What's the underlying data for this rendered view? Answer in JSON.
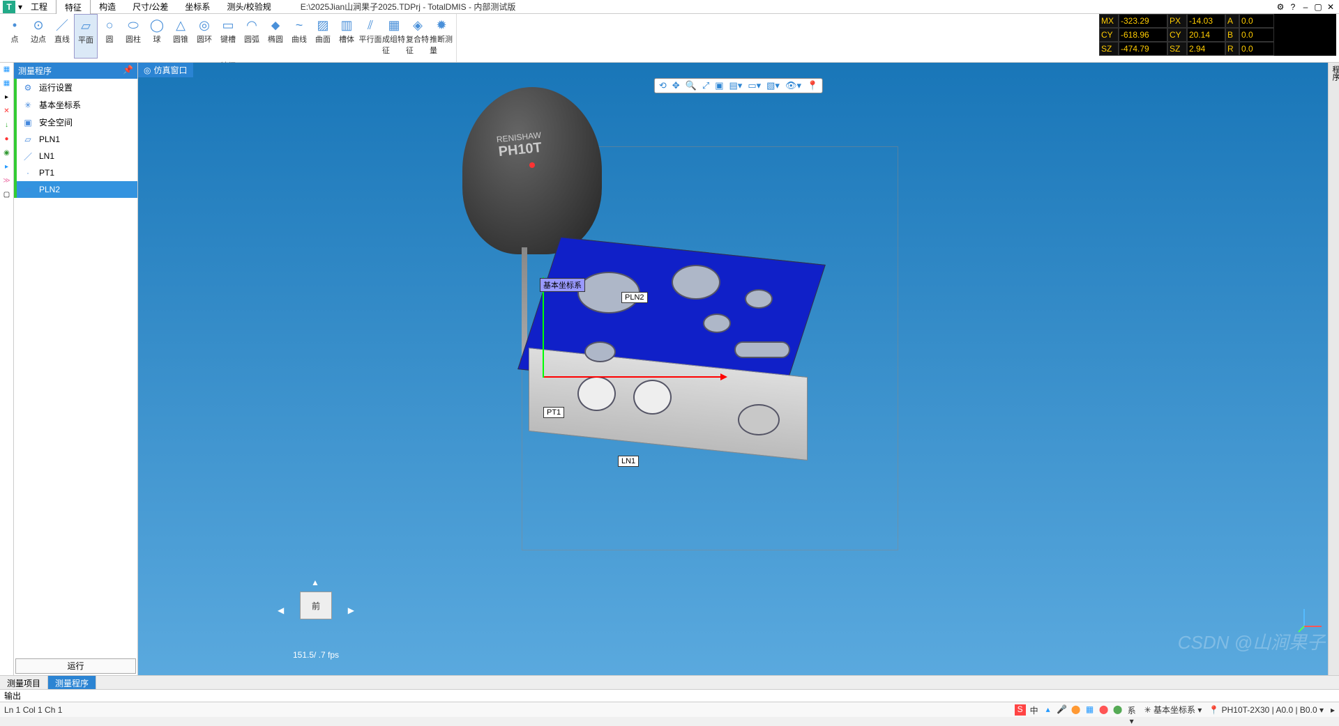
{
  "title_path": "E:\\2025Jian山涧果子2025.TDPrj - TotalDMIS - 内部测试版",
  "app_letter": "T",
  "menu": [
    "工程",
    "特征",
    "构造",
    "尺寸/公差",
    "坐标系",
    "测头/校验规"
  ],
  "active_menu": 1,
  "ribbon_group_label": "特征",
  "ribbon_items": [
    "点",
    "边点",
    "直线",
    "平面",
    "圆",
    "圆柱",
    "球",
    "圆锥",
    "圆环",
    "键槽",
    "圆弧",
    "椭圆",
    "曲线",
    "曲面",
    "槽体",
    "平行面",
    "成组特征",
    "复合特征",
    "推断测量"
  ],
  "ribbon_active": 3,
  "dro": {
    "rows": [
      {
        "l1": "MX",
        "v1": "-323.29",
        "l2": "PX",
        "v2": "-14.03",
        "l3": "A",
        "v3": "0.0"
      },
      {
        "l1": "CY",
        "v1": "-618.96",
        "l2": "CY",
        "v2": "20.14",
        "l3": "B",
        "v3": "0.0"
      },
      {
        "l1": "SZ",
        "v1": "-474.79",
        "l2": "SZ",
        "v2": "2.94",
        "l3": "R",
        "v3": "0.0"
      }
    ]
  },
  "panel_title": "测量程序",
  "tree": [
    {
      "label": "运行设置",
      "icon": "⚙"
    },
    {
      "label": "基本坐标系",
      "icon": "✳"
    },
    {
      "label": "安全空间",
      "icon": "▣"
    },
    {
      "label": "PLN1",
      "icon": "▱"
    },
    {
      "label": "LN1",
      "icon": "／"
    },
    {
      "label": "PT1",
      "icon": "·"
    },
    {
      "label": "PLN2",
      "icon": "▱"
    }
  ],
  "tree_selected": 6,
  "run_button": "运行",
  "viewport_tab": "仿真窗口",
  "probe_brand": "RENISHAW",
  "probe_model": "PH10T",
  "model_labels": {
    "cs": "基本坐标系",
    "pln2": "PLN2",
    "pt1": "PT1",
    "ln1": "LN1"
  },
  "navcube_face": "前",
  "fps": "151.5/   .7 fps",
  "bottom_tabs": [
    "测量项目",
    "测量程序"
  ],
  "bottom_active": 1,
  "output_label": "输出",
  "status": {
    "pos": "Ln 1   Col 1   Ch 1",
    "ime": "中",
    "coord": "基本坐标系 ▾",
    "probe": "PH10T-2X30 | A0.0 | B0.0 ▾"
  },
  "watermark": "CSDN @山涧果子",
  "vscroll_label": "程序"
}
